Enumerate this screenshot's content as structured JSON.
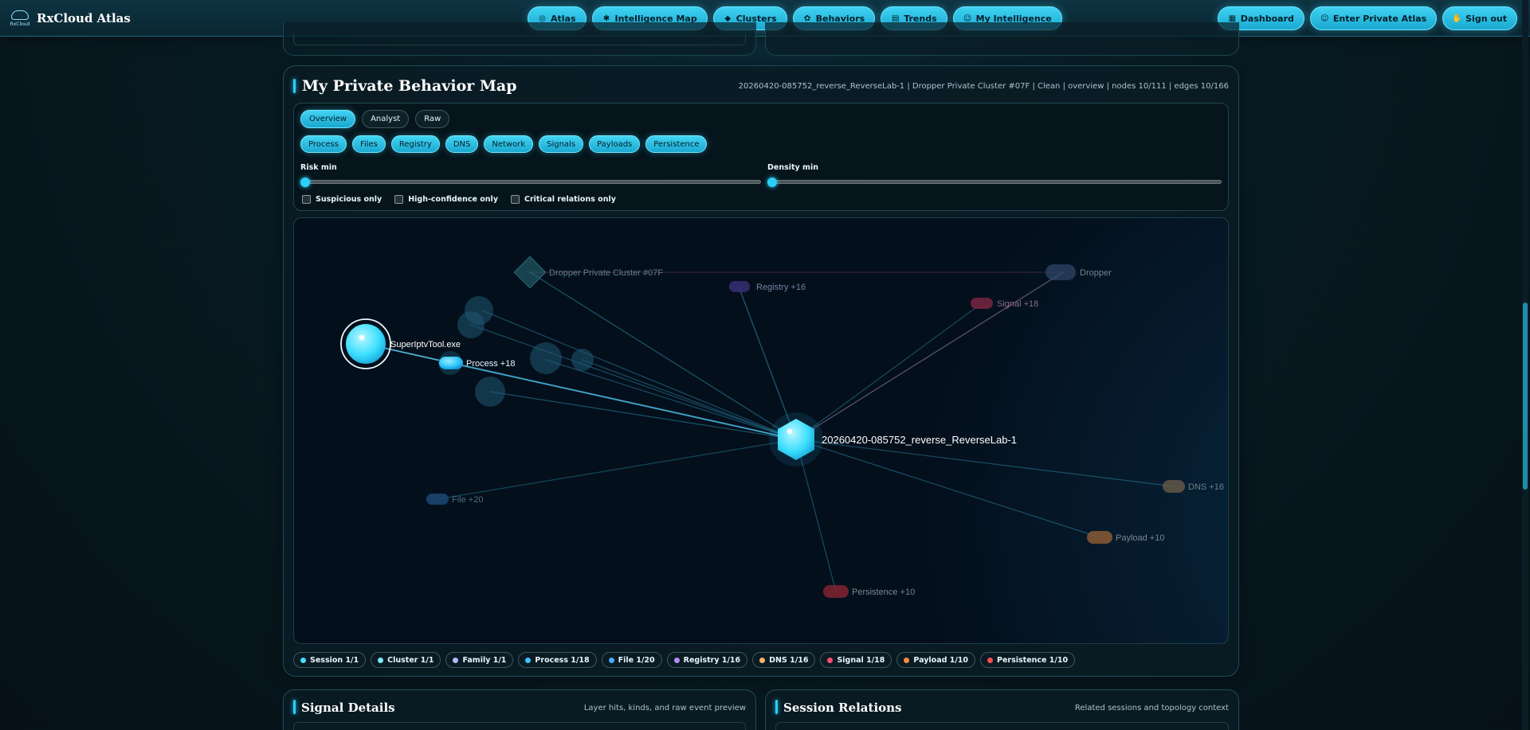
{
  "brand": {
    "name": "RxCloud Atlas",
    "logo_caption": "RxCloud"
  },
  "nav": [
    {
      "label": "Atlas",
      "icon": "globe-icon",
      "glyph": "◎"
    },
    {
      "label": "Intelligence Map",
      "icon": "brain-icon",
      "glyph": "✱"
    },
    {
      "label": "Clusters",
      "icon": "diamond-icon",
      "glyph": "◆"
    },
    {
      "label": "Behaviors",
      "icon": "flower-icon",
      "glyph": "✿"
    },
    {
      "label": "Trends",
      "icon": "chart-icon",
      "glyph": "▤"
    },
    {
      "label": "My Intelligence",
      "icon": "user-icon",
      "glyph": "☺"
    }
  ],
  "right_nav": [
    {
      "label": "Dashboard",
      "icon": "book-icon",
      "glyph": "▦"
    },
    {
      "label": "Enter Private Atlas",
      "icon": "user-icon",
      "glyph": "☺"
    },
    {
      "label": "Sign out",
      "icon": "hand-icon",
      "glyph": "✋"
    }
  ],
  "panel": {
    "title": "My Private Behavior Map",
    "meta": "20260420-085752_reverse_ReverseLab-1 | Dropper Private Cluster #07F | Clean | overview | nodes 10/111 | edges 10/166"
  },
  "modes": [
    "Overview",
    "Analyst",
    "Raw"
  ],
  "active_mode": "Overview",
  "layers": [
    "Process",
    "Files",
    "Registry",
    "DNS",
    "Network",
    "Signals",
    "Payloads",
    "Persistence"
  ],
  "sliders": [
    {
      "label": "Risk min",
      "value": 0
    },
    {
      "label": "Density min",
      "value": 0
    }
  ],
  "checks": [
    "Suspicious only",
    "High-confidence only",
    "Critical relations only"
  ],
  "graph": {
    "center": "20260420-085752_reverse_ReverseLab-1",
    "process_node": "SuperIptvTool.exe",
    "labels": {
      "cluster": "Dropper Private Cluster #07F",
      "registry": "Registry +16",
      "family": "Dropper",
      "signal": "Signal +18",
      "process": "Process +18",
      "dns": "DNS +16",
      "payload": "Payload +10",
      "file": "File +20",
      "persistence": "Persistence +10"
    },
    "colors": {
      "session": "#3fe0ff",
      "process": "#3cc6ff",
      "edge": "#2b8aa8",
      "signal": "#ff4d6d",
      "payload": "#ff9a3c",
      "persistence": "#ff4d4d",
      "registry": "#9b7cff",
      "file": "#4aa8ff",
      "dns": "#f0a15a"
    }
  },
  "legend": [
    {
      "label": "Session 1/1",
      "color": "#3fe0ff"
    },
    {
      "label": "Cluster 1/1",
      "color": "#7ee8ff"
    },
    {
      "label": "Family 1/1",
      "color": "#b5b8ff"
    },
    {
      "label": "Process 1/18",
      "color": "#3cc6ff"
    },
    {
      "label": "File 1/20",
      "color": "#4aa8ff"
    },
    {
      "label": "Registry 1/16",
      "color": "#b38cff"
    },
    {
      "label": "DNS 1/16",
      "color": "#ffb366"
    },
    {
      "label": "Signal 1/18",
      "color": "#ff4d6d"
    },
    {
      "label": "Payload 1/10",
      "color": "#ff8c3c"
    },
    {
      "label": "Persistence 1/10",
      "color": "#ff4d4d"
    }
  ],
  "bottom": [
    {
      "title": "Signal Details",
      "sub": "Layer hits, kinds, and raw event preview"
    },
    {
      "title": "Session Relations",
      "sub": "Related sessions and topology context"
    }
  ]
}
